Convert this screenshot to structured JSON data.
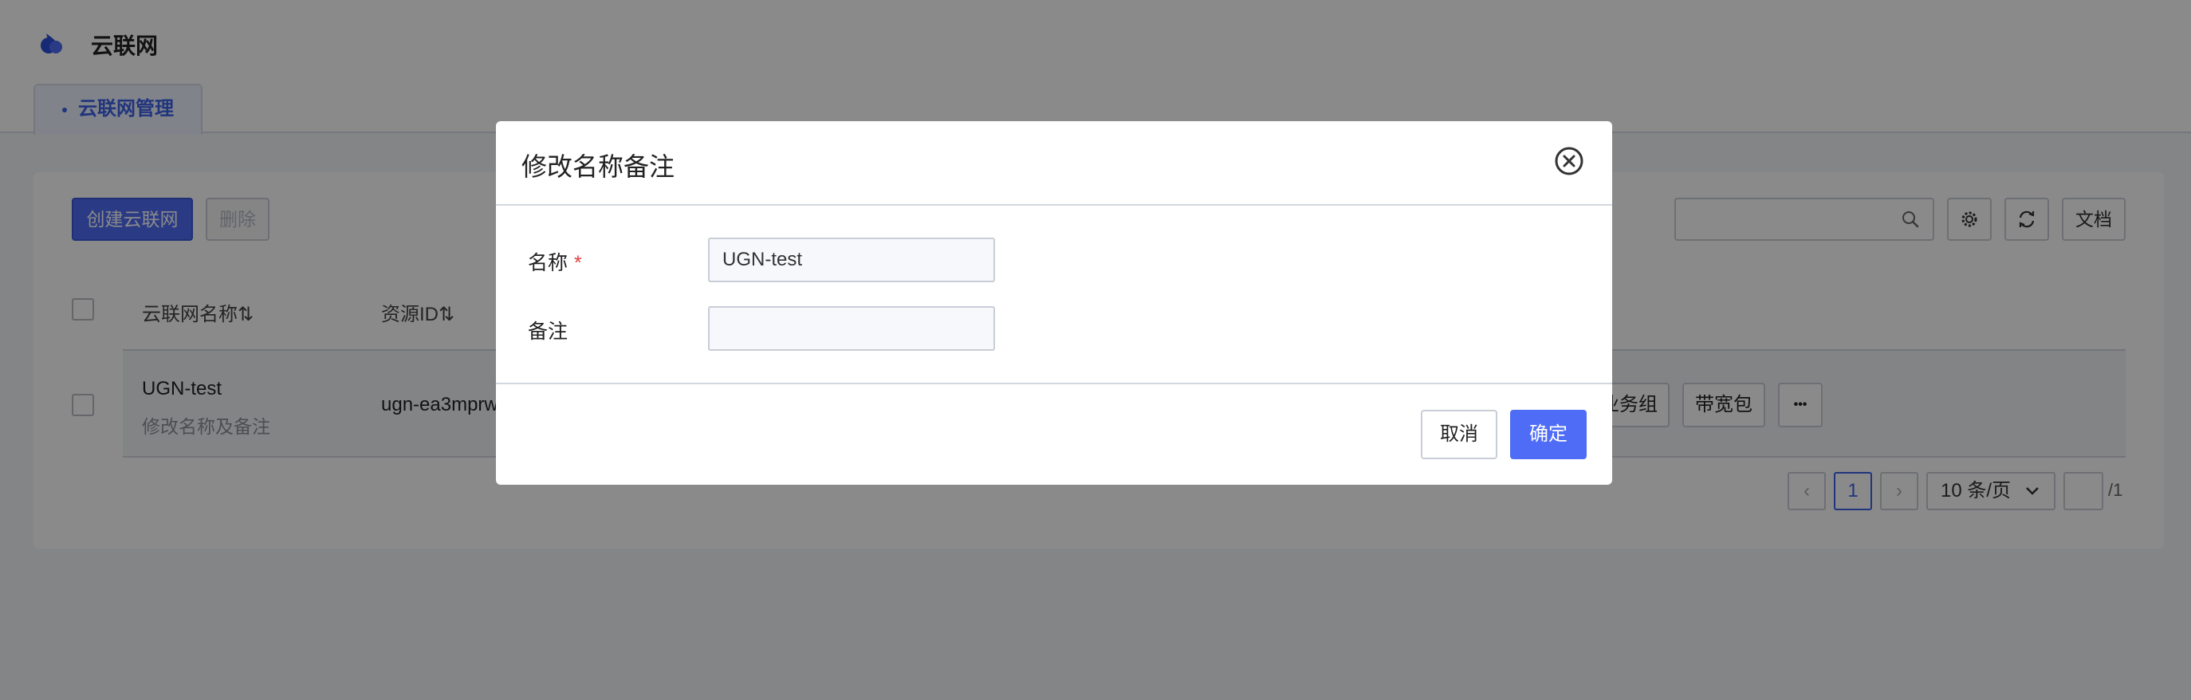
{
  "app": {
    "title": "云联网"
  },
  "tabs": [
    {
      "label": "云联网管理"
    }
  ],
  "toolbar": {
    "create_label": "创建云联网",
    "delete_label": "删除",
    "search_placeholder": "",
    "docs_label": "文档"
  },
  "table": {
    "columns": [
      "云联网名称⇅",
      "资源ID⇅"
    ],
    "rows": [
      {
        "name": "UGN-test",
        "sub_link": "修改名称及备注",
        "resource_id": "ugn-ea3mprw",
        "actions": [
          "业务组",
          "带宽包"
        ],
        "more_label": "•••"
      }
    ]
  },
  "pagination": {
    "prev": "‹",
    "current_page": "1",
    "next": "›",
    "page_size": "10 条/页",
    "total_pages": "/1"
  },
  "modal": {
    "title": "修改名称备注",
    "fields": {
      "name_label": "名称",
      "name_required_mark": "*",
      "name_value": "UGN-test",
      "remark_label": "备注",
      "remark_value": ""
    },
    "cancel_label": "取消",
    "confirm_label": "确定"
  },
  "colors": {
    "accent": "#4f6cf6",
    "required": "#e23d3d",
    "overlay": "rgba(0,0,0,0.46)"
  },
  "icons": [
    "cloud-logo-icon",
    "search-icon",
    "gear-icon",
    "refresh-icon",
    "chevron-down-icon",
    "close-circle-icon"
  ]
}
